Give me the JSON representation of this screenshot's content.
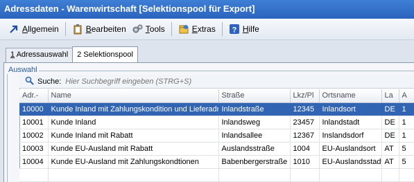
{
  "window": {
    "title": "Adressdaten - Warenwirtschaft [Selektionspool für Export]"
  },
  "menu": [
    {
      "label": "Allgemein",
      "icon": "arrow-icon"
    },
    {
      "label": "Bearbeiten",
      "icon": "clipboard-icon"
    },
    {
      "label": "Tools",
      "icon": "gears-icon"
    },
    {
      "label": "Extras",
      "icon": "extras-icon"
    },
    {
      "label": "Hilfe",
      "icon": "help-icon"
    }
  ],
  "tabs": [
    {
      "num": "1",
      "rest": " Adressauswahl"
    },
    {
      "num": "2",
      "rest": " Selektionspool"
    }
  ],
  "group": {
    "label": "Auswahl"
  },
  "search": {
    "label": "Suche:",
    "placeholder": "Hier Suchbegriff eingeben (STRG+S)"
  },
  "table": {
    "columns": [
      "Adr.-",
      "Name",
      "Straße",
      "Lkz/Pl",
      "Ortsname",
      "La",
      "A"
    ],
    "rows": [
      [
        "10000",
        "Kunde Inland mit Zahlungskondition und Lieferadr.",
        "Inlandstraße",
        "12345",
        "Inlandsort",
        "DE",
        "1"
      ],
      [
        "10001",
        "Kunde Inland",
        "Inlandsweg",
        "23457",
        "Inlandstadt",
        "DE",
        "1"
      ],
      [
        "10002",
        "Kunde Inland mit Rabatt",
        "Inlandsallee",
        "12367",
        "Inslandsdorf",
        "DE",
        "1"
      ],
      [
        "10003",
        "Kunde EU-Ausland mit Rabatt",
        "Auslandsstraße",
        "1004",
        "EU-Auslandsort",
        "AT",
        "5"
      ],
      [
        "10004",
        "Kunde EU-Ausland mit Zahlungskondtionen",
        "Babenbergerstraße",
        "1010",
        "EU-Auslandsstadt",
        "AT",
        "5"
      ]
    ],
    "selected_row": 0
  },
  "colors": {
    "title_bg": "#2f6fcf",
    "selection": "#3165b3",
    "accent_text": "#2a5aa0"
  }
}
